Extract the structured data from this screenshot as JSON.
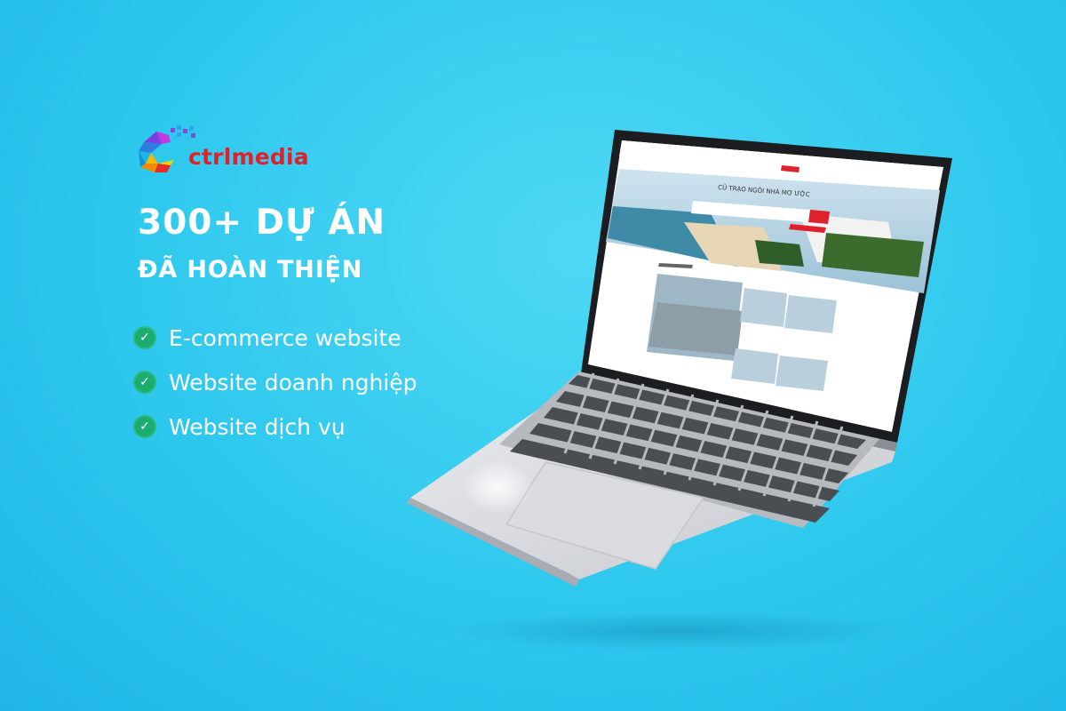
{
  "brand": {
    "name": "ctrlmedia"
  },
  "hero": {
    "headline": "300+ DỰ ÁN",
    "subheadline": "ĐÃ HOÀN THIỆN"
  },
  "features": [
    {
      "label": "E-commerce website",
      "icon": "check-circle-icon"
    },
    {
      "label": "Website doanh nghiệp",
      "icon": "check-circle-icon"
    },
    {
      "label": "Website dịch vụ",
      "icon": "check-circle-icon"
    }
  ],
  "laptop_screen": {
    "hero_text": "CỦ TRẠO NGÔI NHÀ MƠ ƯỚC"
  },
  "colors": {
    "background": "#2ec8ee",
    "brand_red": "#e0212d",
    "check_green": "#1dac6f",
    "text": "#ffffff"
  }
}
